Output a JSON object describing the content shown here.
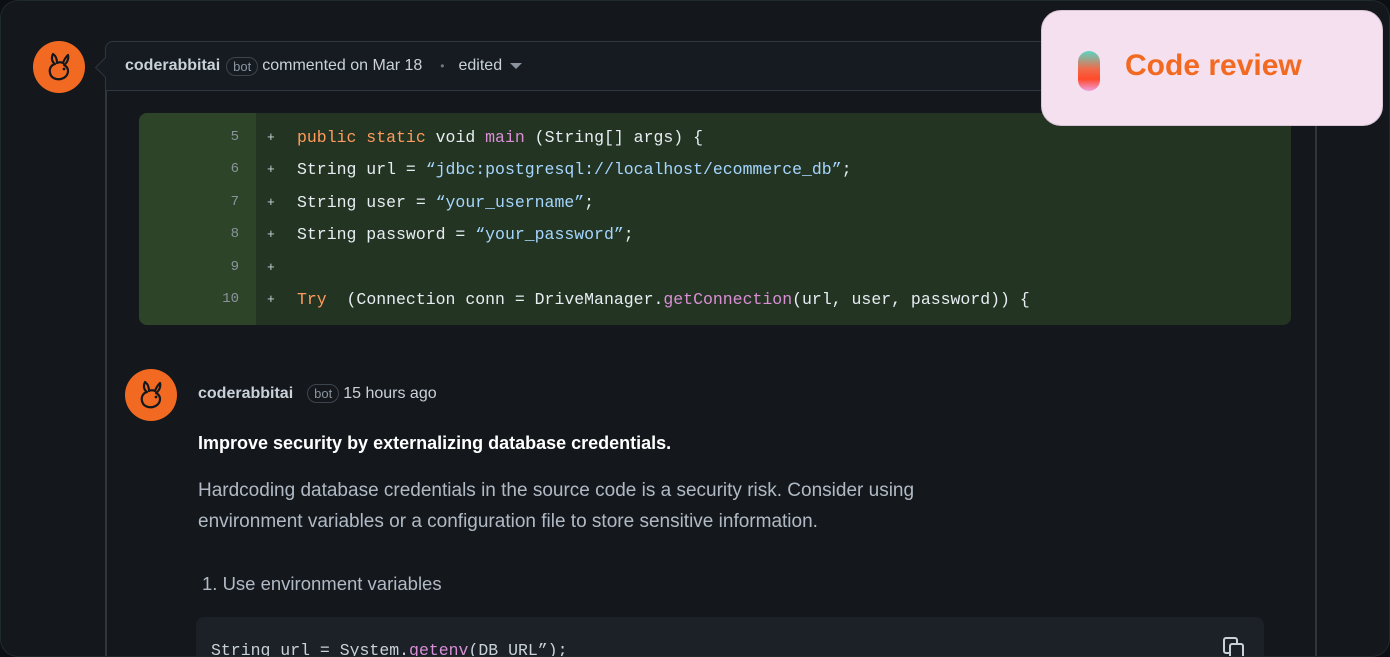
{
  "comment": {
    "author": "coderabbitai",
    "badge": "bot",
    "meta": "commented on Mar 18",
    "separator": "•",
    "edited_label": "edited"
  },
  "diff": {
    "lines": [
      {
        "number": "5",
        "marker": "+"
      },
      {
        "number": "6",
        "marker": "+"
      },
      {
        "number": "7",
        "marker": "+"
      },
      {
        "number": "8",
        "marker": "+"
      },
      {
        "number": "9",
        "marker": "+"
      },
      {
        "number": "10",
        "marker": "+"
      }
    ],
    "code": {
      "l5_kw": "public static",
      "l5_a": " void ",
      "l5_fn": "main",
      "l5_b": " (String[] args) {",
      "l6_a": "String url = ",
      "l6_str": "“jdbc:postgresql://localhost/ecommerce_db”",
      "l6_b": ";",
      "l7_a": "String user = ",
      "l7_str": "“your_username”",
      "l7_b": ";",
      "l8_a": "String password = ",
      "l8_str": "“your_password”",
      "l8_b": ";",
      "l10_kw": "Try",
      "l10_a": "  (Connection conn = DriveManager.",
      "l10_fn": "getConnection",
      "l10_b": "(url, user, password)) {"
    }
  },
  "reply": {
    "author": "coderabbitai",
    "badge": "bot",
    "time": "15 hours ago",
    "title": "Improve security by externalizing database credentials.",
    "text_line1": "Hardcoding database credentials in the source code is a security risk. Consider using",
    "text_line2": "environment variables or a configuration file to store sensitive information.",
    "step": "1. Use environment variables",
    "snippet_a": "String url = System.",
    "snippet_fn": "getenv",
    "snippet_b": "(DB_URL”);"
  },
  "badge_overlay": {
    "label": "Code review"
  },
  "colors": {
    "accent": "#f26a21",
    "diff_bg": "#243422",
    "badge_bg": "#f4e0ef"
  },
  "icons": [
    "rabbit-avatar-icon",
    "chevron-down-icon",
    "copy-icon",
    "gradient-pill-icon"
  ]
}
